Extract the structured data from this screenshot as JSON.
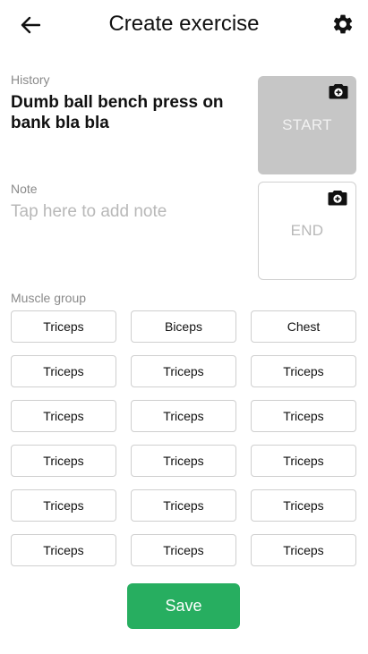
{
  "header": {
    "title": "Create exercise"
  },
  "history": {
    "label": "History",
    "value": "Dumb ball bench press on bank bla bla"
  },
  "note": {
    "label": "Note",
    "placeholder": "Tap here to add note"
  },
  "photos": {
    "start_label": "START",
    "end_label": "END"
  },
  "muscle_group": {
    "label": "Muscle group",
    "chips": [
      "Triceps",
      "Biceps",
      "Chest",
      "Triceps",
      "Triceps",
      "Triceps",
      "Triceps",
      "Triceps",
      "Triceps",
      "Triceps",
      "Triceps",
      "Triceps",
      "Triceps",
      "Triceps",
      "Triceps",
      "Triceps",
      "Triceps",
      "Triceps"
    ]
  },
  "actions": {
    "save_label": "Save"
  },
  "icons": {
    "back": "arrow-left-icon",
    "settings": "gear-icon",
    "camera": "camera-icon"
  },
  "colors": {
    "accent": "#27ae60",
    "start_box": "#c6c6c6"
  }
}
